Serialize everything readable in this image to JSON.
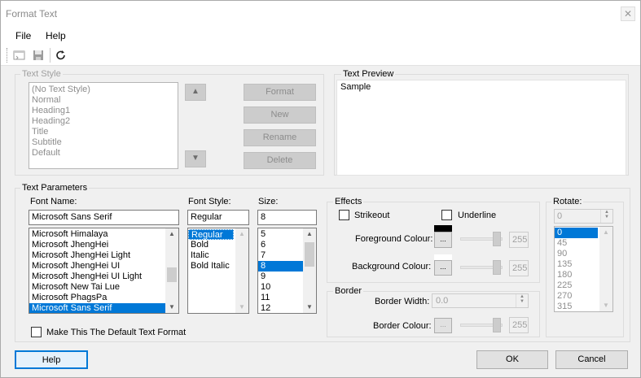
{
  "window": {
    "title": "Format Text",
    "close": "✕"
  },
  "menu": {
    "file": "File",
    "help": "Help"
  },
  "toolbar": {
    "icons": [
      "apply-icon",
      "save-icon",
      "refresh-icon"
    ]
  },
  "text_style": {
    "legend": "Text Style",
    "items": [
      "(No Text Style)",
      "Normal",
      "Heading1",
      "Heading2",
      "Title",
      "Subtitle",
      "Default"
    ],
    "up": "▲",
    "down": "▼",
    "buttons": {
      "format": "Format",
      "new": "New",
      "rename": "Rename",
      "delete": "Delete"
    }
  },
  "text_preview": {
    "legend": "Text Preview",
    "sample": "Sample"
  },
  "text_parameters": {
    "legend": "Text Parameters",
    "font_name_label": "Font Name:",
    "font_name_value": "Microsoft Sans Serif",
    "fonts": [
      "Microsoft Himalaya",
      "Microsoft JhengHei",
      "Microsoft JhengHei Light",
      "Microsoft JhengHei UI",
      "Microsoft JhengHei UI Light",
      "Microsoft New Tai Lue",
      "Microsoft PhagsPa",
      "Microsoft Sans Serif"
    ],
    "font_style_label": "Font Style:",
    "font_style_value": "Regular",
    "styles": [
      "Regular",
      "Bold",
      "Italic",
      "Bold Italic"
    ],
    "size_label": "Size:",
    "size_value": "8",
    "sizes": [
      "5",
      "6",
      "7",
      "8",
      "9",
      "10",
      "11",
      "12"
    ],
    "default_checkbox": "Make This The Default Text Format"
  },
  "effects": {
    "legend": "Effects",
    "strikeout": "Strikeout",
    "underline": "Underline",
    "foreground_label": "Foreground Colour:",
    "foreground_value": "255",
    "background_label": "Background Colour:",
    "background_value": "255",
    "ellipsis": "...",
    "fg_color": "#000000",
    "bg_color": "#ffffff"
  },
  "border": {
    "legend": "Border",
    "width_label": "Border Width:",
    "width_value": "0.0",
    "colour_label": "Border Colour:",
    "colour_value": "255",
    "ellipsis": "..."
  },
  "rotate": {
    "legend": "Rotate:",
    "value": "0",
    "options": [
      "0",
      "45",
      "90",
      "135",
      "180",
      "225",
      "270",
      "315"
    ]
  },
  "footer": {
    "help": "Help",
    "ok": "OK",
    "cancel": "Cancel"
  },
  "colors": {
    "selection": "#0078d7",
    "accent_border": "#0078d7"
  }
}
